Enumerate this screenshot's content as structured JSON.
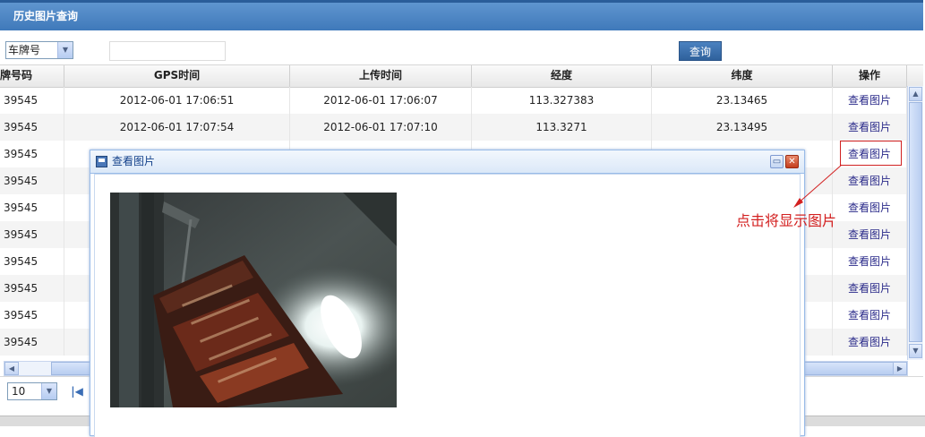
{
  "panel": {
    "title": "历史图片查询"
  },
  "toolbar": {
    "field_select": "车牌号",
    "query_button": "查询",
    "search_value": ""
  },
  "table": {
    "columns": [
      "车牌号码",
      "GPS时间",
      "上传时间",
      "经度",
      "纬度",
      "操作"
    ],
    "rows": [
      {
        "plate": "39545",
        "gps_time": "2012-06-01 17:06:51",
        "upload_time": "2012-06-01 17:06:07",
        "lng": "113.327383",
        "lat": "23.13465",
        "action": "查看图片"
      },
      {
        "plate": "39545",
        "gps_time": "2012-06-01 17:07:54",
        "upload_time": "2012-06-01 17:07:10",
        "lng": "113.3271",
        "lat": "23.13495",
        "action": "查看图片"
      },
      {
        "plate": "39545",
        "gps_time": "",
        "upload_time": "",
        "lng": "",
        "lat": "",
        "action": "查看图片"
      },
      {
        "plate": "39545",
        "gps_time": "",
        "upload_time": "",
        "lng": "",
        "lat": "",
        "action": "查看图片"
      },
      {
        "plate": "39545",
        "gps_time": "",
        "upload_time": "",
        "lng": "",
        "lat": "",
        "action": "查看图片"
      },
      {
        "plate": "39545",
        "gps_time": "",
        "upload_time": "",
        "lng": "",
        "lat": "",
        "action": "查看图片"
      },
      {
        "plate": "39545",
        "gps_time": "",
        "upload_time": "",
        "lng": "",
        "lat": "",
        "action": "查看图片"
      },
      {
        "plate": "39545",
        "gps_time": "",
        "upload_time": "",
        "lng": "",
        "lat": "",
        "action": "查看图片"
      },
      {
        "plate": "39545",
        "gps_time": "",
        "upload_time": "",
        "lng": "",
        "lat": "",
        "action": "查看图片"
      },
      {
        "plate": "39545",
        "gps_time": "",
        "upload_time": "",
        "lng": "",
        "lat": "",
        "action": "查看图片"
      }
    ]
  },
  "pager": {
    "page_size": "10"
  },
  "dialog": {
    "title": "查看图片",
    "minimize_glyph": "▭",
    "close_glyph": "✕"
  },
  "annotation": {
    "text": "点击将显示图片"
  },
  "icons": {
    "save": "floppy-disk-icon",
    "dropdown": "chevron-down-icon",
    "first_page": "first-page-icon"
  },
  "colors": {
    "header_blue": "#3f79ba",
    "link": "#2b2b8a",
    "annotation_red": "#d32020"
  }
}
